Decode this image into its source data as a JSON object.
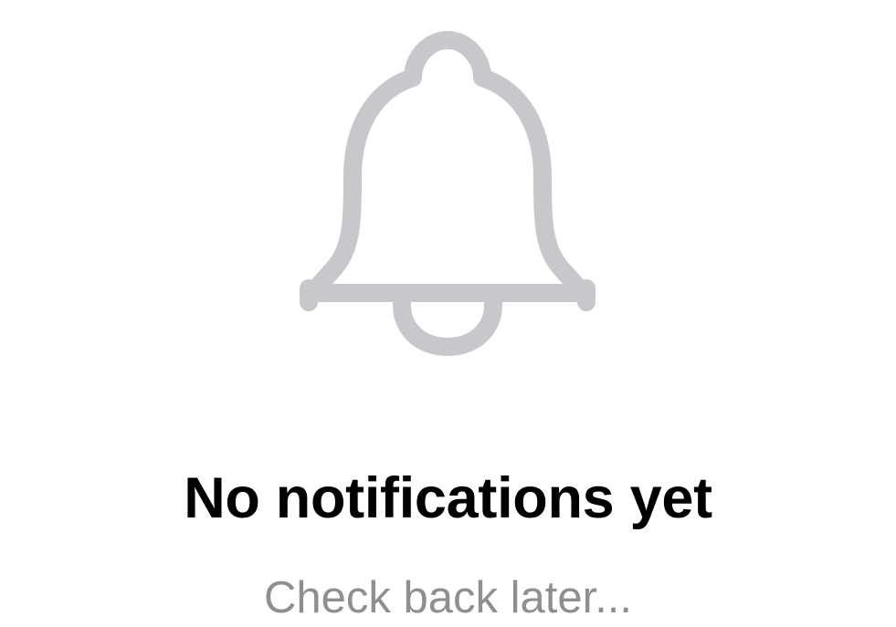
{
  "empty_state": {
    "icon": "bell-icon",
    "icon_color": "#c7c7cc",
    "title": "No notifications yet",
    "subtitle": "Check back later..."
  }
}
